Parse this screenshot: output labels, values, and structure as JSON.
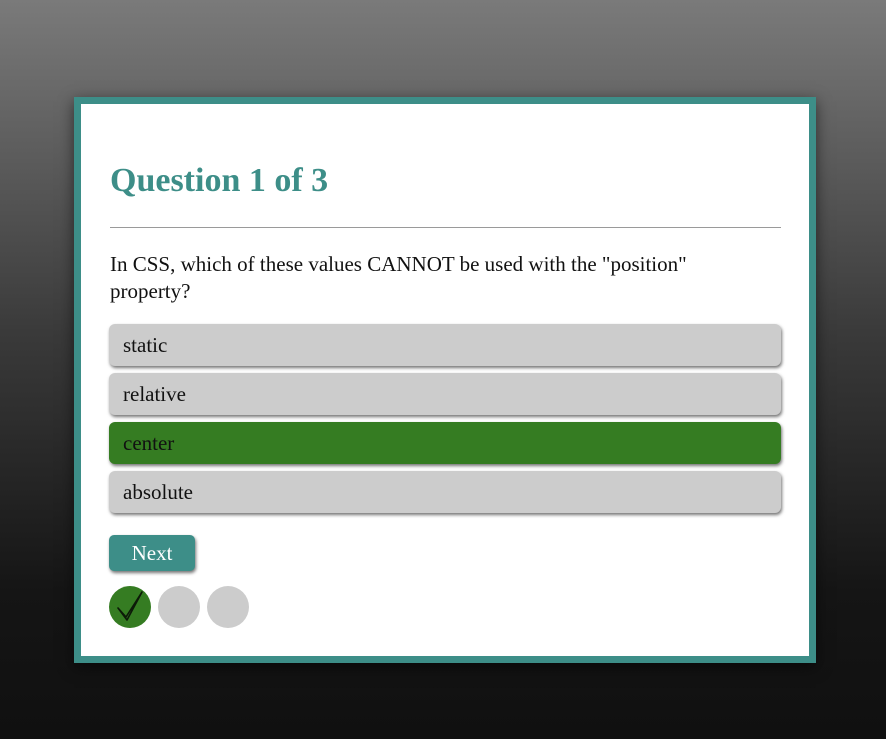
{
  "quiz": {
    "title": "Question 1 of 3",
    "question": "In CSS, which of these values CANNOT be used with the \"position\" property?",
    "answers": [
      {
        "label": "static",
        "state": "default"
      },
      {
        "label": "relative",
        "state": "default"
      },
      {
        "label": "center",
        "state": "correct"
      },
      {
        "label": "absolute",
        "state": "default"
      }
    ],
    "next_label": "Next",
    "progress": [
      {
        "status": "correct",
        "icon": "checkmark-icon"
      },
      {
        "status": "pending",
        "icon": ""
      },
      {
        "status": "pending",
        "icon": ""
      }
    ]
  },
  "colors": {
    "accent": "#3d8e88",
    "correct": "#357c22",
    "answer_bg": "#cccccc",
    "page_background_top": "#7a7a7a",
    "page_background_bottom": "#101010"
  }
}
